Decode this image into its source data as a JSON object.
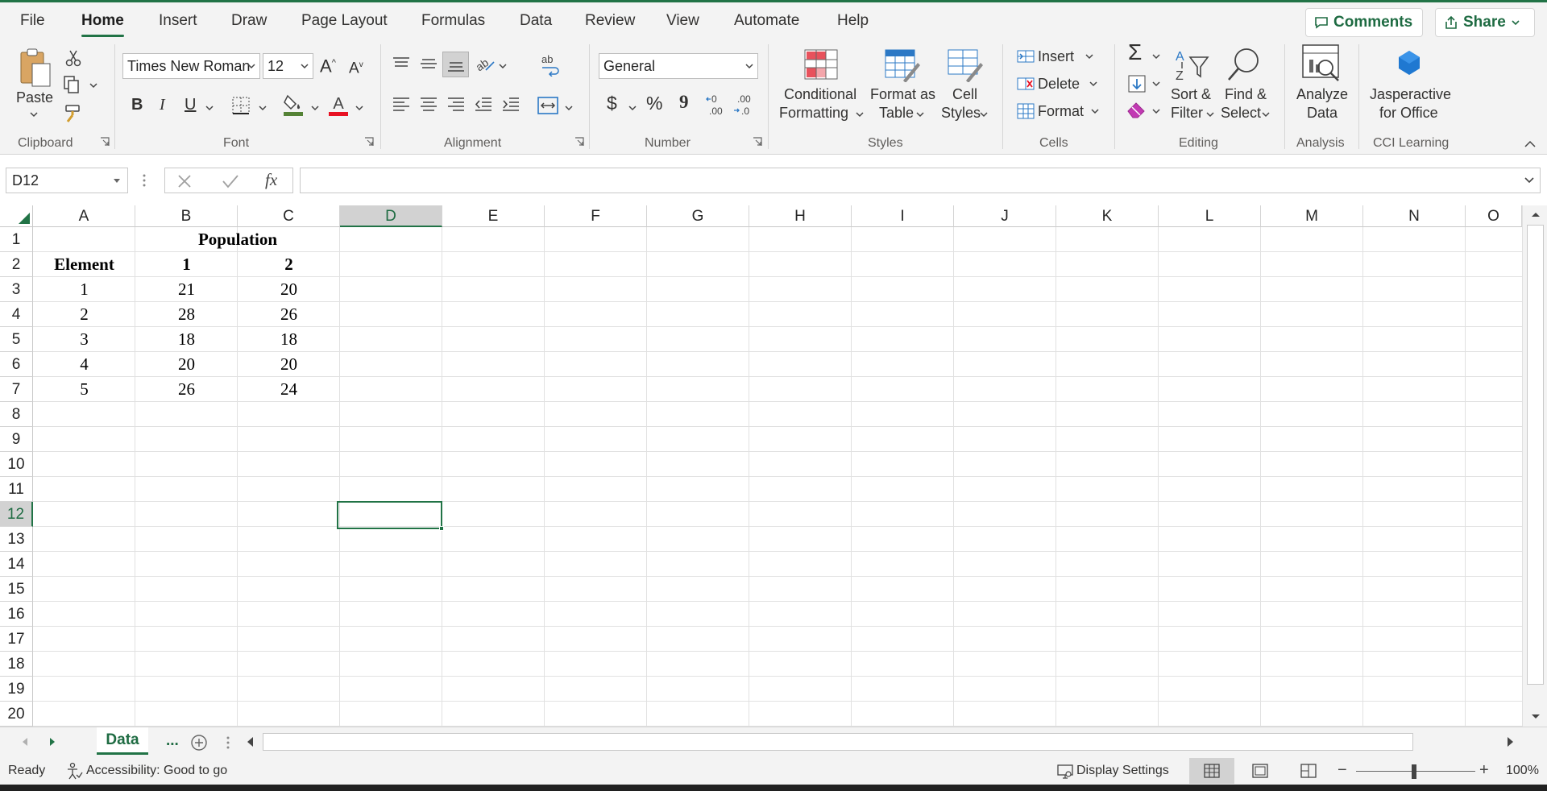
{
  "menu": {
    "tabs": [
      "File",
      "Home",
      "Insert",
      "Draw",
      "Page Layout",
      "Formulas",
      "Data",
      "Review",
      "View",
      "Automate",
      "Help"
    ],
    "active": "Home",
    "comments_label": "Comments",
    "share_label": "Share"
  },
  "ribbon": {
    "clipboard": {
      "paste": "Paste",
      "group": "Clipboard"
    },
    "font": {
      "name": "Times New Roman",
      "size": "12",
      "bold": "B",
      "italic": "I",
      "underline": "U",
      "group": "Font",
      "fill_color": "#548235",
      "font_color": "#e81123"
    },
    "alignment": {
      "group": "Alignment"
    },
    "number": {
      "format": "General",
      "currency": "$",
      "percent": "%",
      "comma": "9",
      "group": "Number"
    },
    "styles": {
      "conditional_1": "Conditional",
      "conditional_2": "Formatting",
      "format_table_1": "Format as",
      "format_table_2": "Table",
      "cell_styles_1": "Cell",
      "cell_styles_2": "Styles",
      "group": "Styles"
    },
    "cells": {
      "insert": "Insert",
      "delete": "Delete",
      "format": "Format",
      "group": "Cells"
    },
    "editing": {
      "sort_1": "Sort &",
      "sort_2": "Filter",
      "find_1": "Find &",
      "find_2": "Select",
      "group": "Editing"
    },
    "analysis": {
      "analyze_1": "Analyze",
      "analyze_2": "Data",
      "group": "Analysis"
    },
    "cci": {
      "jasper_1": "Jasperactive",
      "jasper_2": "for Office",
      "group": "CCI Learning"
    }
  },
  "formula_bar": {
    "name_box": "D12",
    "fx": "fx",
    "formula": ""
  },
  "grid": {
    "columns": [
      "A",
      "B",
      "C",
      "D",
      "E",
      "F",
      "G",
      "H",
      "I",
      "J",
      "K",
      "L",
      "M",
      "N",
      "O"
    ],
    "rows": [
      "1",
      "2",
      "3",
      "4",
      "5",
      "6",
      "7",
      "8",
      "9",
      "10",
      "11",
      "12",
      "13",
      "14",
      "15",
      "16",
      "17",
      "18",
      "19",
      "20"
    ],
    "selected_column": "D",
    "selected_row": "12",
    "title": "Population",
    "headers": [
      "Element",
      "1",
      "2"
    ],
    "data": [
      [
        "1",
        "21",
        "20"
      ],
      [
        "2",
        "28",
        "26"
      ],
      [
        "3",
        "18",
        "18"
      ],
      [
        "4",
        "20",
        "20"
      ],
      [
        "5",
        "26",
        "24"
      ]
    ]
  },
  "sheet_tabs": {
    "active": "Data",
    "more": "..."
  },
  "status": {
    "ready": "Ready",
    "accessibility": "Accessibility: Good to go",
    "display_settings": "Display Settings",
    "zoom": "100%"
  }
}
